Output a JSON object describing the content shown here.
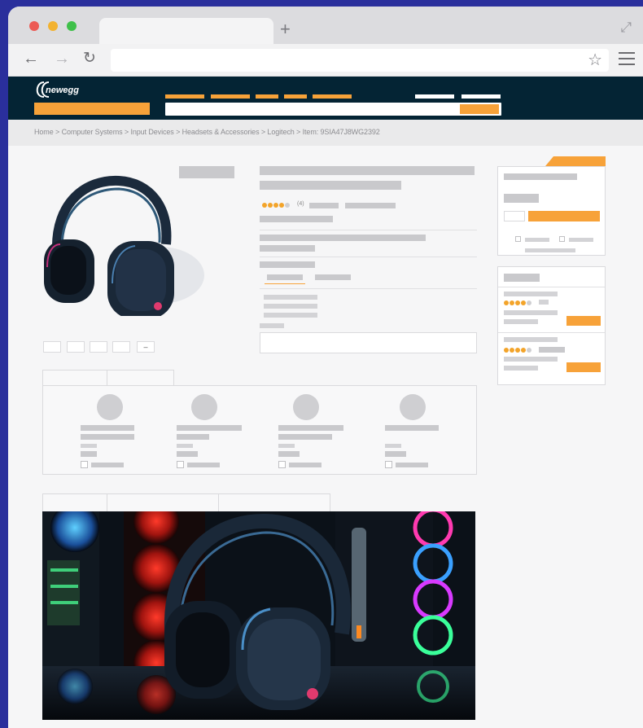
{
  "browser": {
    "new_tab_symbol": "+",
    "url": "",
    "window_controls": [
      "close",
      "minimize",
      "maximize"
    ],
    "nav_icons": [
      "back-arrow-icon",
      "forward-arrow-icon",
      "reload-icon"
    ]
  },
  "site": {
    "logo_text": "newegg",
    "accent_color": "#f7a239",
    "header_color": "#042434"
  },
  "breadcrumb": {
    "text": "Home > Computer Systems > Input Devices > Headsets & Accessories > Logitech > Item: 9SIA47J8WG2392"
  },
  "product": {
    "rating_count": "(4)",
    "thumbnails_more": "–"
  },
  "sidebar_offers": [
    {
      "stars": 4
    },
    {
      "stars": 4
    }
  ]
}
